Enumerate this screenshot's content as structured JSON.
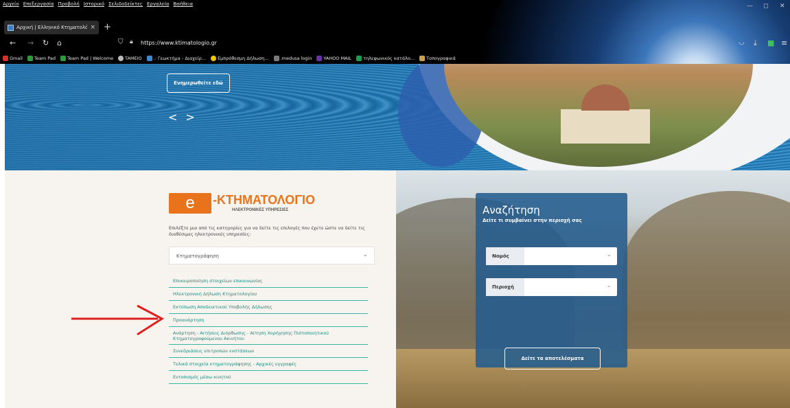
{
  "browser": {
    "menu": [
      "Αρχείο",
      "Επεξεργασία",
      "Προβολή",
      "Ιστορικό",
      "Σελιδοδείκτες",
      "Εργαλεία",
      "Βοήθεια"
    ],
    "tab_title": "Αρχική | Ελληνικό Κτηματολόγιο",
    "new_tab_symbol": "+",
    "tab_close_symbol": "×",
    "url": "https://www.ktimatologio.gr",
    "bookmarks": [
      {
        "label": "Gmail",
        "color": "#d93025"
      },
      {
        "label": "Team Pad",
        "color": "#2e9b3a"
      },
      {
        "label": "Team Pad | Welcome",
        "color": "#2e9b3a"
      },
      {
        "label": "TAMEIO",
        "color": "#bbbbbb"
      },
      {
        "label": ".: Γεωκτήμα - Διαχείρ...",
        "color": "#3a8bd1"
      },
      {
        "label": "Εμπρόθεσμη Δήλωση...",
        "color": "#f2c400"
      },
      {
        "label": ".medusa login",
        "color": "#7a7a7a"
      },
      {
        "label": "YAHOO MAIL",
        "color": "#6f2da8"
      },
      {
        "label": "τηλεφωνικός κατάλο...",
        "color": "#1c9f4e"
      },
      {
        "label": "Τοπογραφικά",
        "color": "#c9a14a"
      }
    ]
  },
  "hero": {
    "button": "Ενημερωθείτε εδώ",
    "prev": "<",
    "next": ">"
  },
  "eservices": {
    "logo_letter": "e",
    "logo_title": "-ΚΤΗΜΑΤΟΛΟΓΙΟ",
    "logo_subtitle": "ΗΛΕΚΤΡΟΝΙΚΕΣ ΥΠΗΡΕΣΙΕΣ",
    "intro": "Επιλέξτε μια από τις κατηγορίες για να δείτε τις επιλογές που έχετε ώστε να δείτε τις διαθέσιμες ηλεκτρονικές υπηρεσίες:",
    "category_selected": "Κτηματογράφηση",
    "links": [
      "Επικαιροποίηση στοιχείων επικοινωνίας",
      "Ηλεκτρονική Δήλωση Κτηματολογίου",
      "Εκτύπωση Αποδεικτικού Υποβολής Δήλωσης",
      "Προανάρτηση",
      "Ανάρτηση - Αιτήσεις Διόρθωσης - Αίτηση Χορήγησης Πιστοποιητικού Κτηματογραφούμενου Ακινήτου",
      "Συνεδριάσεις επιτροπών ενστάσεων",
      "Τελικά στοιχεία κτηματογράφησης - Αρχικές εγγραφές",
      "Εντοπισμός μέσω κινητού"
    ]
  },
  "search": {
    "title": "Αναζήτηση",
    "subtitle": "Δείτε τι συμβαίνει στην περιοχή σας",
    "field1_label": "Νομός",
    "field2_label": "Περιοχή",
    "submit": "Δείτε τα αποτελέσματα"
  },
  "colors": {
    "accent_orange": "#e8731b",
    "link_teal": "#1a8a7d",
    "panel_blue": "#245c8e",
    "arrow_red": "#e02020"
  }
}
